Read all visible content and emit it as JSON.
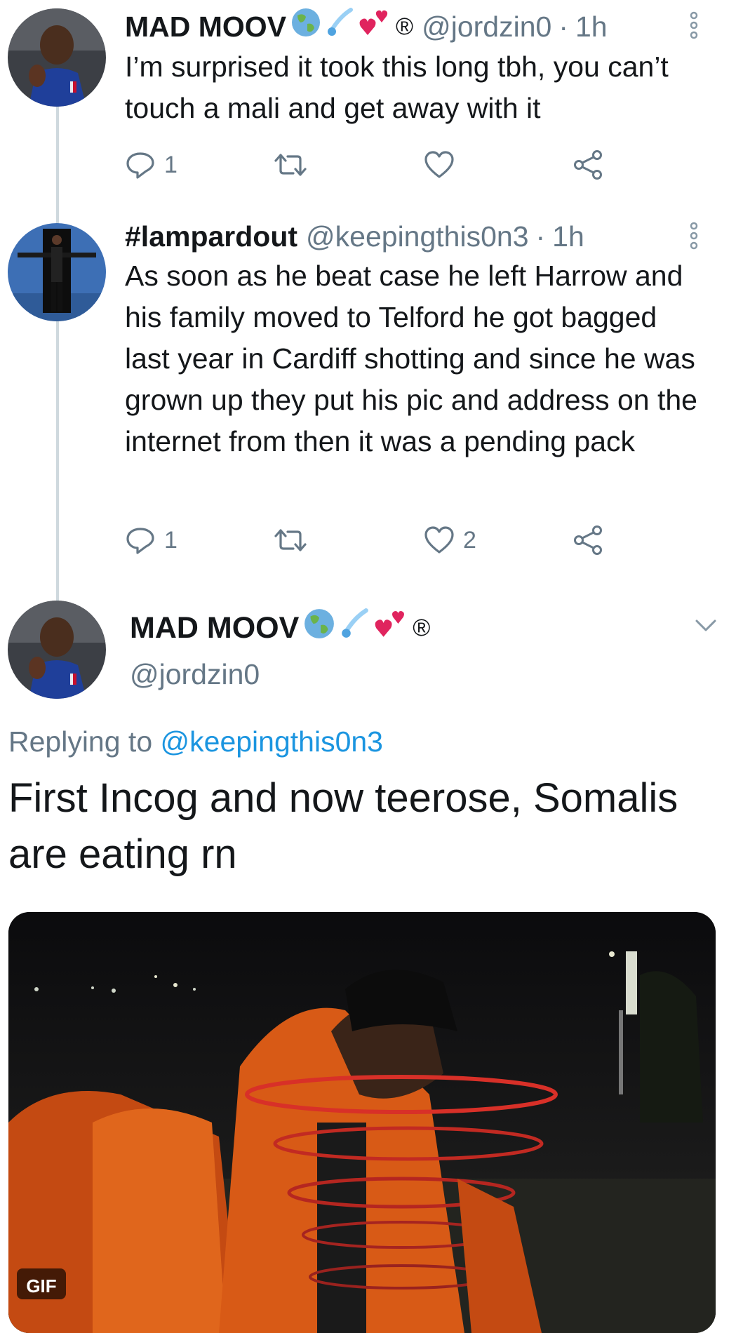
{
  "tweet1": {
    "display_name": "MAD MOOV",
    "badge": "®",
    "handle": "@jordzin0",
    "time": "1h",
    "text": "I’m surprised it took this long tbh, you can’t touch a mali and get away with it",
    "reply_count": "1",
    "retweet_count": "",
    "like_count": ""
  },
  "tweet2": {
    "display_name": "#lampardout",
    "handle": "@keepingthis0n3",
    "time": "1h",
    "text": "As soon as he beat case he left Harrow and his family moved to Telford he got bagged last year in Cardiff shotting and since he was grown up they put his pic and address on the internet from then it was a pending pack",
    "reply_count": "1",
    "retweet_count": "",
    "like_count": "2"
  },
  "main_tweet": {
    "display_name": "MAD MOOV",
    "badge": "®",
    "handle": "@jordzin0",
    "replying_prefix": "Replying to",
    "replying_handle": "@keepingthis0n3",
    "text": "First Incog and now teerose, Somalis are eating rn",
    "media_badge": "GIF"
  },
  "separator": "·",
  "colors": {
    "secondary_text": "#657786",
    "link": "#1b95e0",
    "thread_line": "#cfd9de"
  },
  "icons": [
    "more-vertical-icon",
    "reply-icon",
    "retweet-icon",
    "like-icon",
    "share-icon",
    "chevron-down-icon",
    "earth-emoji",
    "comet-emoji",
    "hearts-emoji"
  ]
}
